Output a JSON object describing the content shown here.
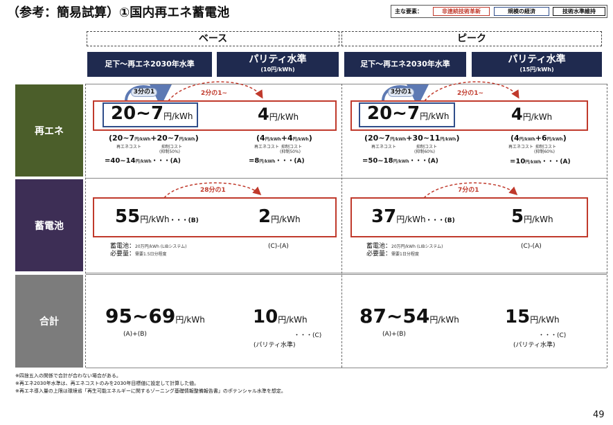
{
  "title": "（参考：簡易試算）①国内再エネ蓄電池",
  "legend": {
    "label": "主な要素：",
    "tags": [
      {
        "text": "非連続技術革新",
        "color": "#c0392b"
      },
      {
        "text": "規模の経済",
        "color": "#2f4d8a"
      },
      {
        "text": "技術水準維持",
        "color": "#111111"
      }
    ]
  },
  "scenarios": {
    "base": {
      "label": "ベース",
      "col1": "足下～再エネ2030年水準",
      "col2_main": "パリティ水準",
      "col2_sub": "(10円/kWh)"
    },
    "peak": {
      "label": "ピーク",
      "col1": "足下～再エネ2030年水準",
      "col2_main": "パリティ水準",
      "col2_sub": "(15円/kWh)"
    }
  },
  "rows": {
    "renewable": "再エネ",
    "battery": "蓄電池",
    "total": "合計"
  },
  "renewable": {
    "base": {
      "arrow_blue": "3分の1",
      "arrow_red": "2分の1~",
      "left_value": "20~7",
      "left_unit": "円/kWh",
      "left_formula_a": "(20~7",
      "left_formula_a_unit": "円/kWh",
      "left_formula_b": "+20~7",
      "left_formula_b_unit": "円/kWh",
      "left_formula_end": ")",
      "left_label_a": "再エネコスト",
      "left_label_b1": "抑制コスト",
      "left_label_b2": "(抑制50%)",
      "left_result": "=40~14",
      "left_result_unit": "円/kWh",
      "left_result_tag": "・・・(A)",
      "right_value": "4",
      "right_unit": "円/kWh",
      "right_formula_a": "(4",
      "right_formula_a_unit": "円/kWh",
      "right_formula_b": "+4",
      "right_formula_b_unit": "円/kWh",
      "right_formula_end": ")",
      "right_label_a": "再エネコスト",
      "right_label_b1": "抑制コスト",
      "right_label_b2": "(抑制50%)",
      "right_result": "=8",
      "right_result_unit": "円/kWh",
      "right_result_tag": "・・・(A)"
    },
    "peak": {
      "arrow_blue": "3分の1",
      "arrow_red": "2分の1~",
      "left_value": "20~7",
      "left_unit": "円/kWh",
      "left_formula_a": "(20~7",
      "left_formula_a_unit": "円/kWh",
      "left_formula_b": "+30~11",
      "left_formula_b_unit": "円/kWh",
      "left_formula_end": ")",
      "left_label_a": "再エネコスト",
      "left_label_b1": "抑制コスト",
      "left_label_b2": "(抑制60%)",
      "left_result": "=50~18",
      "left_result_unit": "円/kWh",
      "left_result_tag": "・・・(A)",
      "right_value": "4",
      "right_unit": "円/kWh",
      "right_formula_a": "(4",
      "right_formula_a_unit": "円/kWh",
      "right_formula_b": "+6",
      "right_formula_b_unit": "円/kWh",
      "right_formula_end": ")",
      "right_label_a": "再エネコスト",
      "right_label_b1": "抑制コスト",
      "right_label_b2": "(抑制60%)",
      "right_result": "=10",
      "right_result_unit": "円/kWh",
      "right_result_tag": "・・・(A)"
    }
  },
  "battery": {
    "base": {
      "arrow_red": "28分の1",
      "left_value": "55",
      "left_unit": "円/kWh",
      "left_tag": "・・・(B)",
      "right_value": "2",
      "right_unit": "円/kWh",
      "note1_a": "蓄電池：",
      "note1_b": "20万円/kWh (LIBシステム)",
      "note2_a": "必要量：",
      "note2_b": "需要1.5日分程度",
      "right_formula": "(C)-(A)"
    },
    "peak": {
      "arrow_red": "7分の1",
      "left_value": "37",
      "left_unit": "円/kWh",
      "left_tag": "・・・(B)",
      "right_value": "5",
      "right_unit": "円/kWh",
      "note1_a": "蓄電池：",
      "note1_b": "20万円/kWh (LIBシステム)",
      "note2_a": "必要量：",
      "note2_b": "需要1日分程度",
      "right_formula": "(C)-(A)"
    }
  },
  "total": {
    "base": {
      "left_value": "95~69",
      "left_unit": "円/kWh",
      "left_formula": "(A)+(B)",
      "right_value": "10",
      "right_unit": "円/kWh",
      "right_tag": "・・・(C)",
      "right_formula": "(パリティ水準)"
    },
    "peak": {
      "left_value": "87~54",
      "left_unit": "円/kWh",
      "left_formula": "(A)+(B)",
      "right_value": "15",
      "right_unit": "円/kWh",
      "right_tag": "・・・(C)",
      "right_formula": "(パリティ水準)"
    }
  },
  "notes": [
    "※四捨五入の関係で合計が合わない場合がある。",
    "※再エネ2030年水準は、再エネコストのみを2030年目標値に設定して計算した値。",
    "※再エネ導入量の上限は環境省「再生可能エネルギーに関するゾーニング基礎情報整備報告書」のポテンシャル水準を想定。"
  ],
  "page_number": "49",
  "colors": {
    "renewable_row": "#4b5e2a",
    "battery_row": "#3d2e55",
    "total_row": "#7c7c7c",
    "header_navy": "#1f2a4f",
    "red": "#c0392b",
    "blue": "#2f4d8a"
  }
}
